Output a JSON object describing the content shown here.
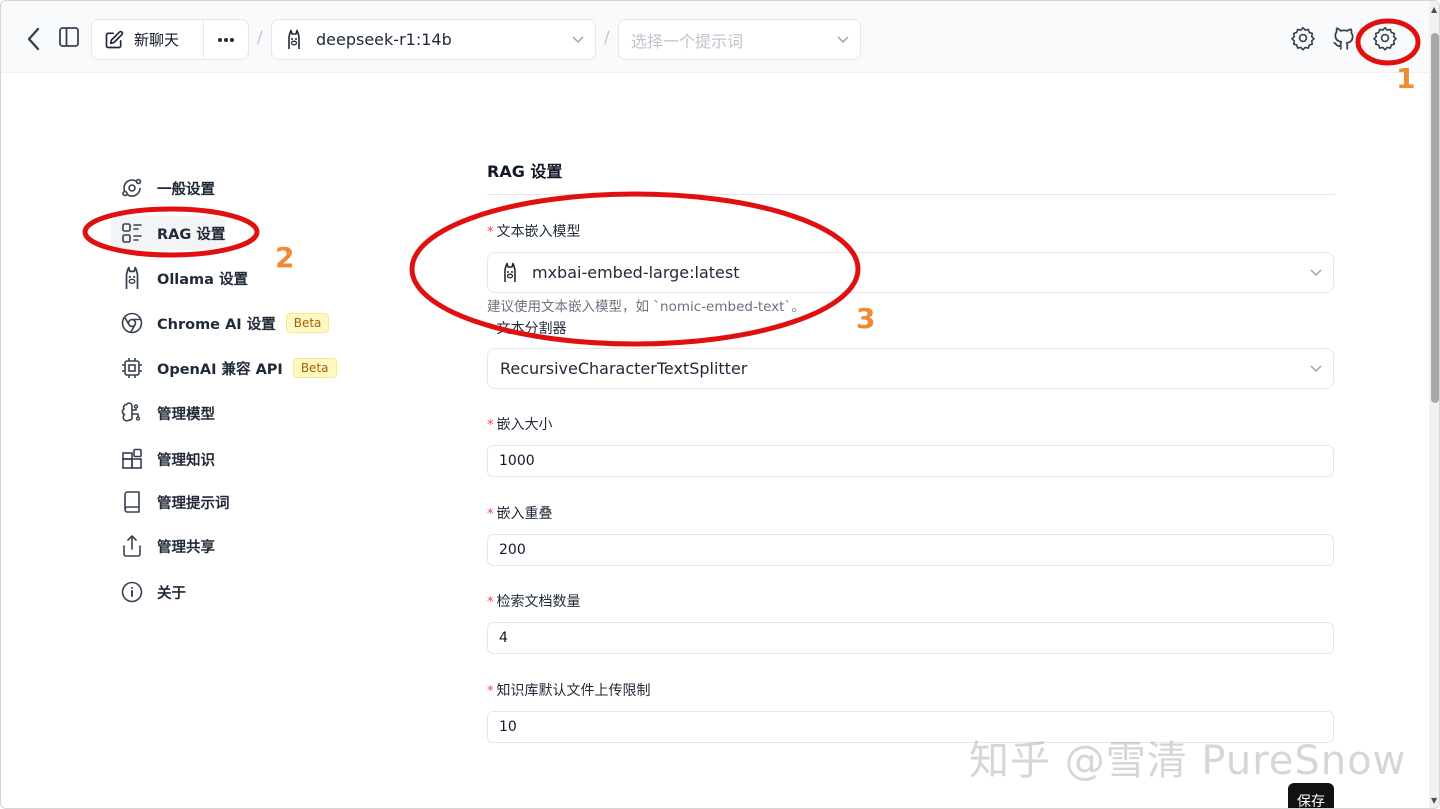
{
  "header": {
    "new_chat_label": "新聊天",
    "model_value": "deepseek-r1:14b",
    "prompt_placeholder": "选择一个提示词",
    "separator": "/"
  },
  "nav": {
    "items": [
      {
        "label": "一般设置",
        "icon": "orbit-icon"
      },
      {
        "label": "RAG 设置",
        "icon": "rag-icon",
        "active": true
      },
      {
        "label": "Ollama 设置",
        "icon": "llama-icon"
      },
      {
        "label": "Chrome AI 设置",
        "icon": "chrome-icon",
        "badge": "Beta"
      },
      {
        "label": "OpenAI 兼容 API",
        "icon": "cpu-icon",
        "badge": "Beta"
      },
      {
        "label": "管理模型",
        "icon": "brain-icon"
      },
      {
        "label": "管理知识",
        "icon": "blocks-icon"
      },
      {
        "label": "管理提示词",
        "icon": "book-icon"
      },
      {
        "label": "管理共享",
        "icon": "share-icon"
      },
      {
        "label": "关于",
        "icon": "info-icon"
      }
    ]
  },
  "main": {
    "title": "RAG 设置",
    "embedding_model": {
      "label": "文本嵌入模型",
      "value": "mxbai-embed-large:latest",
      "hint": "建议使用文本嵌入模型，如 `nomic-embed-text`。"
    },
    "splitter": {
      "label": "文本分割器",
      "value": "RecursiveCharacterTextSplitter"
    },
    "chunk_size": {
      "label": "嵌入大小",
      "value": "1000"
    },
    "chunk_overlap": {
      "label": "嵌入重叠",
      "value": "200"
    },
    "retrieval_docs": {
      "label": "检索文档数量",
      "value": "4"
    },
    "upload_limit": {
      "label": "知识库默认文件上传限制",
      "value": "10"
    },
    "save_label": "保存"
  },
  "annotations": {
    "numbers": [
      "1",
      "2",
      "3"
    ],
    "color": "#e01010",
    "number_color": "#f08b34"
  },
  "watermark": "知乎 @雪清 PureSnow"
}
